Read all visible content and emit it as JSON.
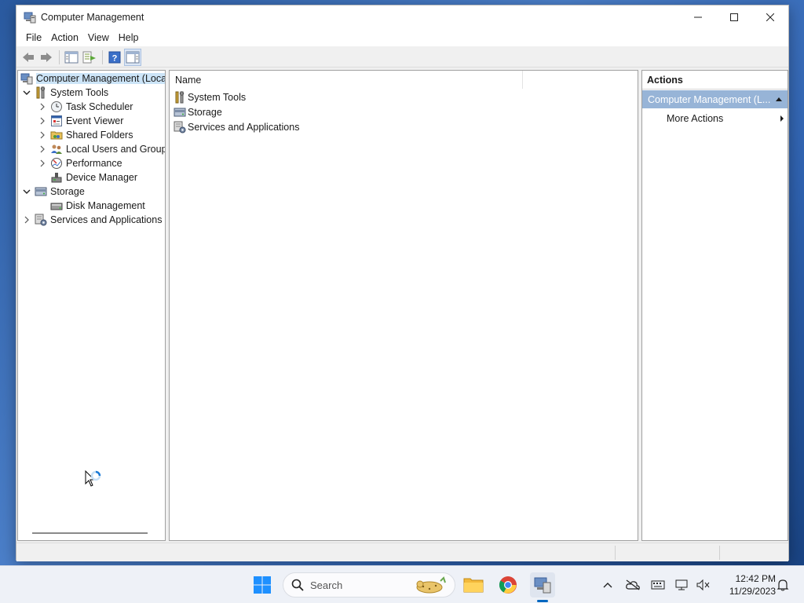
{
  "window": {
    "title": "Computer Management",
    "icon": "computer-management-icon"
  },
  "menu": [
    "File",
    "Action",
    "View",
    "Help"
  ],
  "toolbar": {
    "buttons": [
      "back-arrow-icon",
      "forward-arrow-icon",
      "show-hide-console-tree-icon",
      "export-list-icon",
      "help-icon",
      "show-hide-action-pane-icon"
    ]
  },
  "tree": {
    "root": "Computer Management (Local",
    "items": [
      {
        "label": "System Tools",
        "icon": "tools-icon",
        "expanded": true
      },
      {
        "label": "Task Scheduler",
        "icon": "clock-icon"
      },
      {
        "label": "Event Viewer",
        "icon": "event-viewer-icon"
      },
      {
        "label": "Shared Folders",
        "icon": "shared-folder-icon"
      },
      {
        "label": "Local Users and Groups",
        "icon": "users-icon"
      },
      {
        "label": "Performance",
        "icon": "performance-icon"
      },
      {
        "label": "Device Manager",
        "icon": "device-manager-icon"
      },
      {
        "label": "Storage",
        "icon": "storage-icon",
        "expanded": true
      },
      {
        "label": "Disk Management",
        "icon": "disk-icon"
      },
      {
        "label": "Services and Applications",
        "icon": "services-icon"
      }
    ]
  },
  "content": {
    "column_name": "Name",
    "items": [
      "System Tools",
      "Storage",
      "Services and Applications"
    ]
  },
  "actions": {
    "header": "Actions",
    "section": "Computer Management (L...",
    "item": "More Actions"
  },
  "taskbar": {
    "search_placeholder": "Search",
    "time": "12:42 PM",
    "date": "11/29/2023"
  },
  "colors": {
    "selection": "#cce4f7",
    "actions_section": "#97b4d7",
    "accent": "#0067c0"
  }
}
